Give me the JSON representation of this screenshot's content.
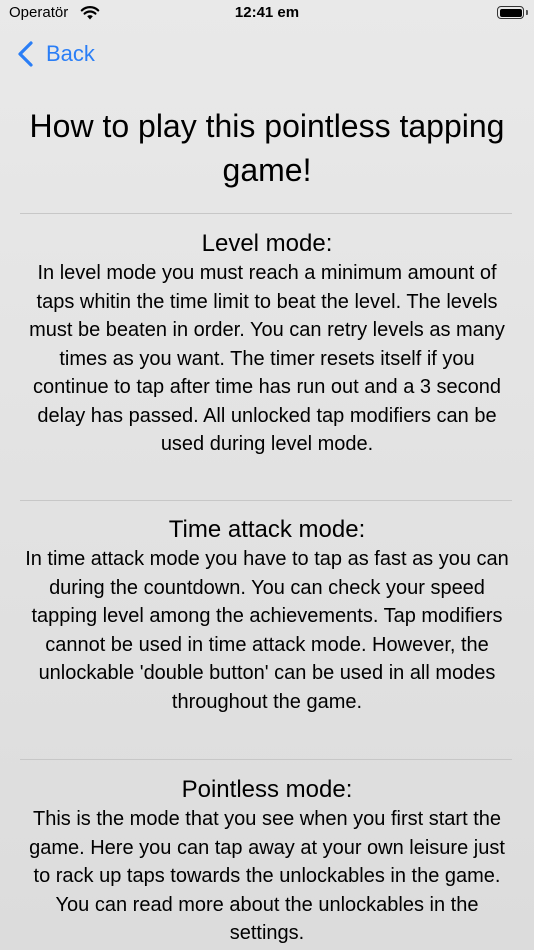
{
  "status_bar": {
    "carrier": "Operatör",
    "time": "12:41 em",
    "wifi_icon": "wifi-icon",
    "battery_icon": "battery-icon"
  },
  "nav": {
    "back_label": "Back",
    "back_icon": "chevron-left-icon",
    "accent_color": "#2a7ef6"
  },
  "title": "How to play this pointless tapping game!",
  "sections": [
    {
      "heading": "Level mode:",
      "body": "In level mode you must reach a minimum amount of taps whitin the time limit to beat the level. The levels must be beaten in order. You can retry levels as many times as you want. The timer resets itself if you continue to tap after time has run out and a 3 second delay has passed. All unlocked tap modifiers can be used during level mode."
    },
    {
      "heading": "Time attack mode:",
      "body": "In time attack mode you have to tap as fast as you can during the countdown. You can check your speed tapping level among the achievements. Tap modifiers cannot be used in time attack mode. However, the unlockable 'double button' can be used in all modes throughout the game."
    },
    {
      "heading": "Pointless mode:",
      "body": "This is the mode that you see when you first start the game. Here you can tap away at your own leisure just to rack up taps towards the unlockables in the game. You can read more about the unlockables in the settings."
    }
  ]
}
